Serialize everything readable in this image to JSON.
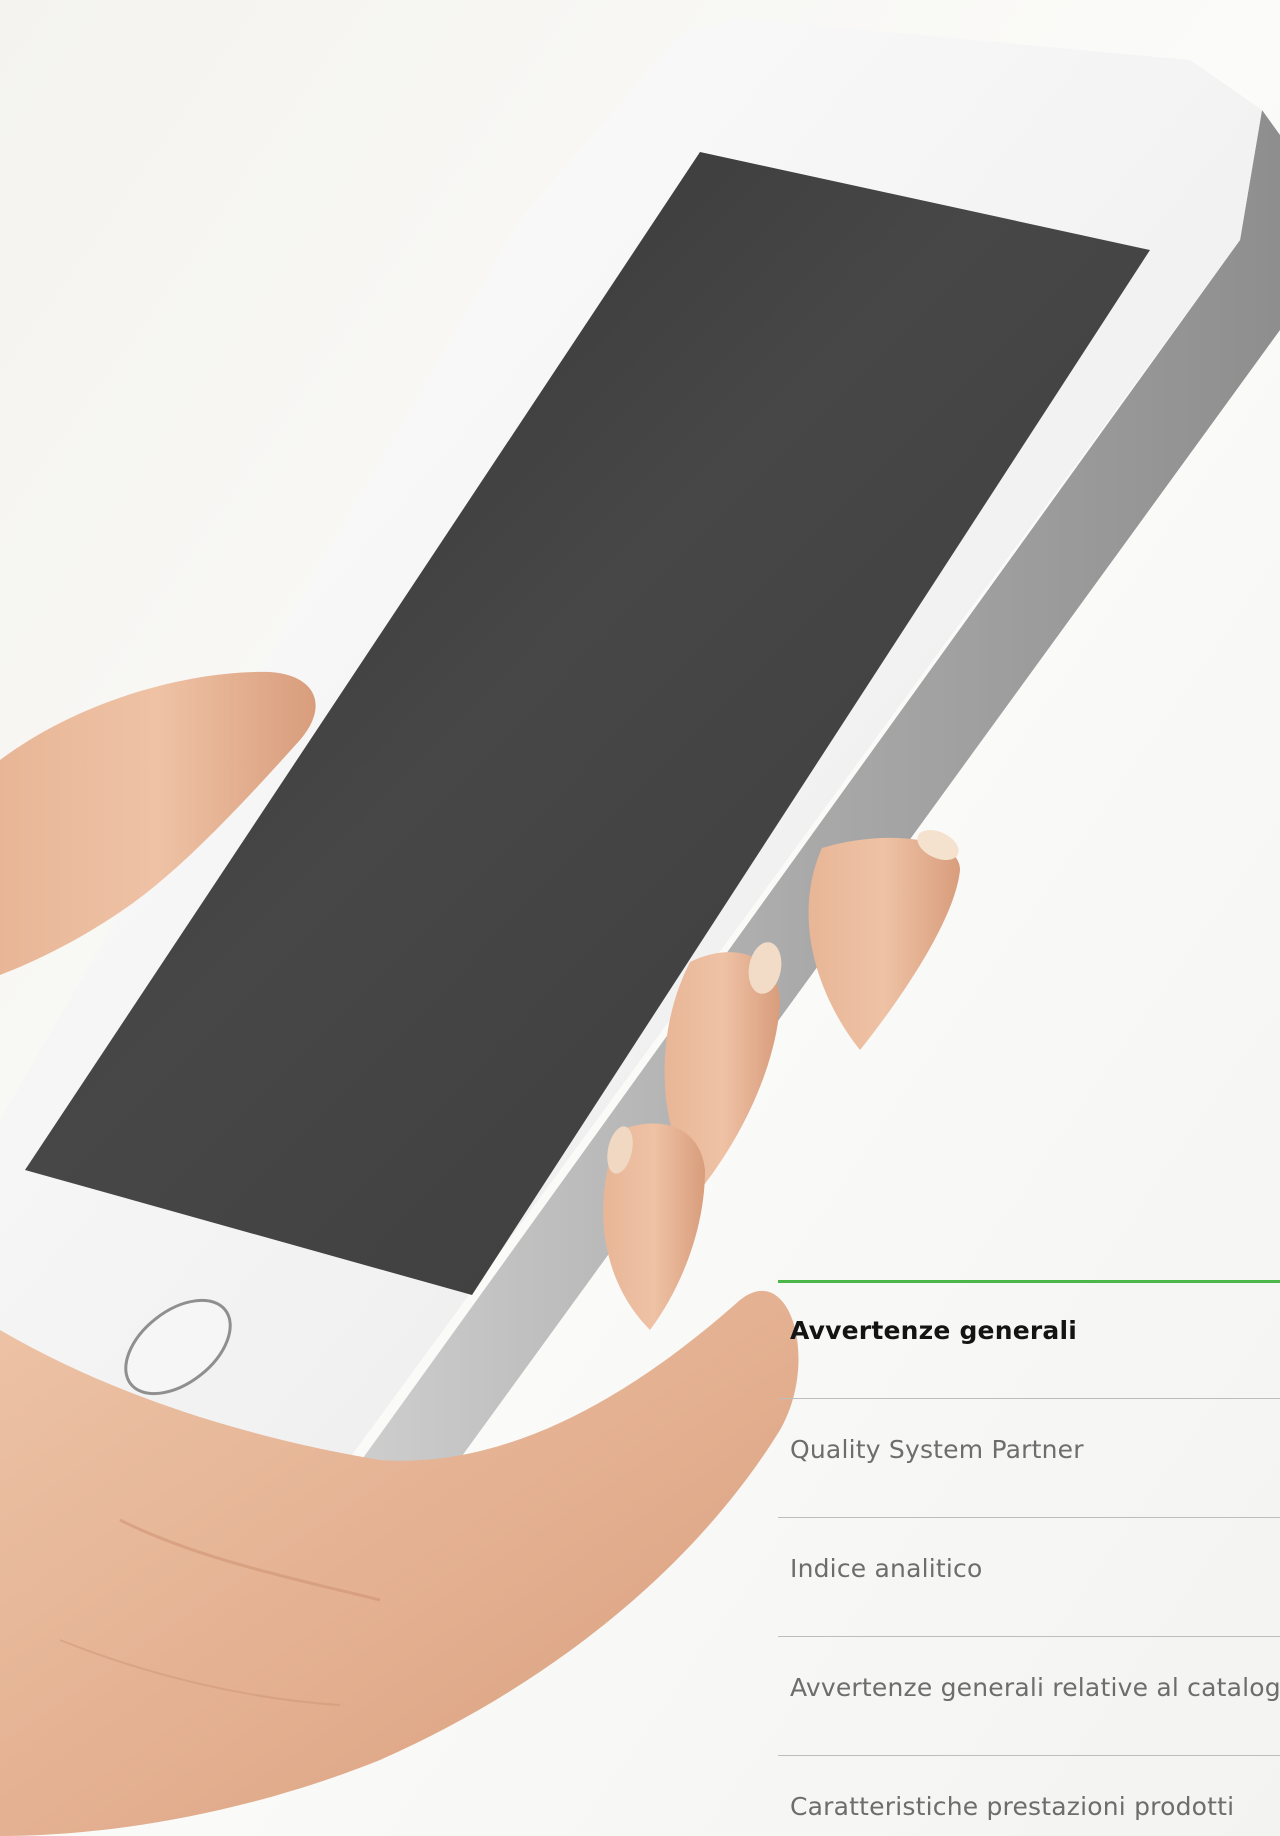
{
  "toc": {
    "items": [
      {
        "label": "Avvertenze generali",
        "active": true
      },
      {
        "label": "Quality System Partner",
        "active": false
      },
      {
        "label": "Indice analitico",
        "active": false
      },
      {
        "label": "Avvertenze generali relative al catalogo",
        "active": false
      },
      {
        "label": "Caratteristiche prestazioni prodotti",
        "active": false
      }
    ],
    "accent_color": "#4bb749"
  },
  "photo": {
    "subject": "hand-holding-smartphone-photo"
  }
}
